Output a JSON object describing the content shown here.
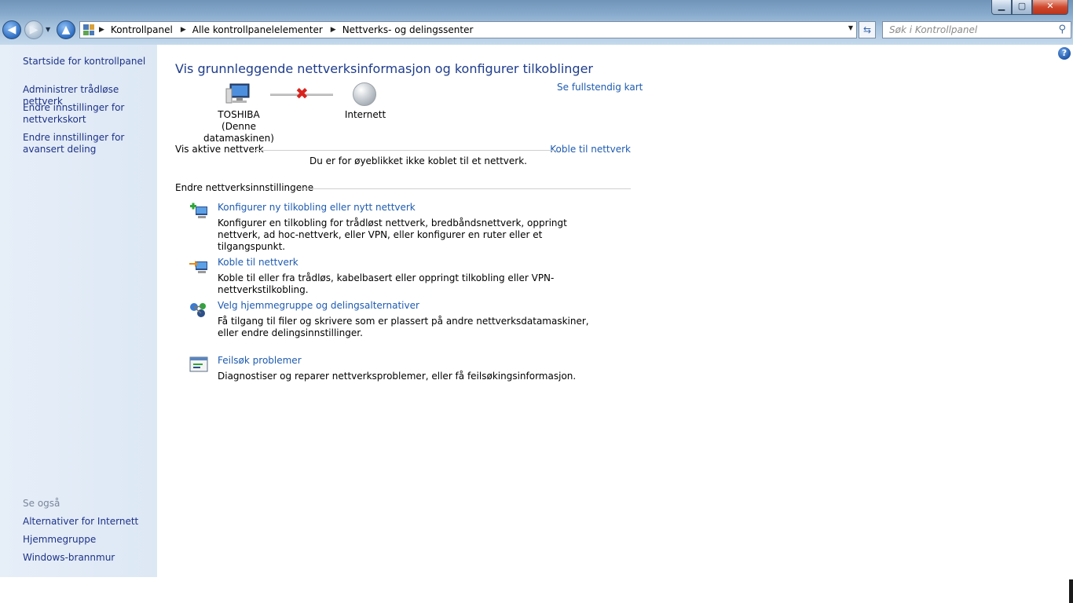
{
  "window": {
    "minimize_label": "▁",
    "maximize_label": "▢",
    "close_label": "✕"
  },
  "nav": {
    "breadcrumbs": [
      "Kontrollpanel",
      "Alle kontrollpanelelementer",
      "Nettverks- og delingssenter"
    ],
    "search_placeholder": "Søk i Kontrollpanel"
  },
  "sidebar": {
    "items": [
      "Startside for kontrollpanel",
      "Administrer trådløse nettverk",
      "Endre innstillinger for nettverkskort",
      "Endre innstillinger for avansert deling"
    ],
    "see_also_heading": "Se også",
    "see_also": [
      "Alternativer for Internett",
      "Hjemmegruppe",
      "Windows-brannmur"
    ]
  },
  "main": {
    "heading": "Vis grunnleggende nettverksinformasjon og konfigurer tilkoblinger",
    "full_map_link": "Se fullstendig kart",
    "computer_name": "TOSHIBA",
    "computer_sub": "(Denne datamaskinen)",
    "internet_label": "Internett",
    "active_networks_label": "Vis aktive nettverk",
    "connect_link": "Koble til nettverk",
    "not_connected_text": "Du er for øyeblikket ikke koblet til et nettverk.",
    "change_settings_label": "Endre nettverksinnstillingene",
    "tasks": [
      {
        "title": "Konfigurer ny tilkobling eller nytt nettverk",
        "desc": "Konfigurer en tilkobling for trådløst nettverk, bredbåndsnettverk, oppringt nettverk, ad hoc-nettverk, eller VPN, eller konfigurer en ruter eller et tilgangspunkt."
      },
      {
        "title": "Koble til nettverk",
        "desc": "Koble til eller fra trådløs, kabelbasert eller oppringt tilkobling eller VPN-nettverkstilkobling."
      },
      {
        "title": "Velg hjemmegruppe og delingsalternativer",
        "desc": "Få tilgang til filer og skrivere som er plassert på andre nettverksdatamaskiner, eller endre delingsinnstillinger."
      },
      {
        "title": "Feilsøk problemer",
        "desc": "Diagnostiser og reparer nettverksproblemer, eller få feilsøkingsinformasjon."
      }
    ]
  },
  "colors": {
    "link": "#1e5bb0",
    "heading": "#1e3c8c",
    "sidebar_link": "#1e3287",
    "sidebar_bg": "#e3ecf7",
    "error_x": "#d8231d"
  }
}
